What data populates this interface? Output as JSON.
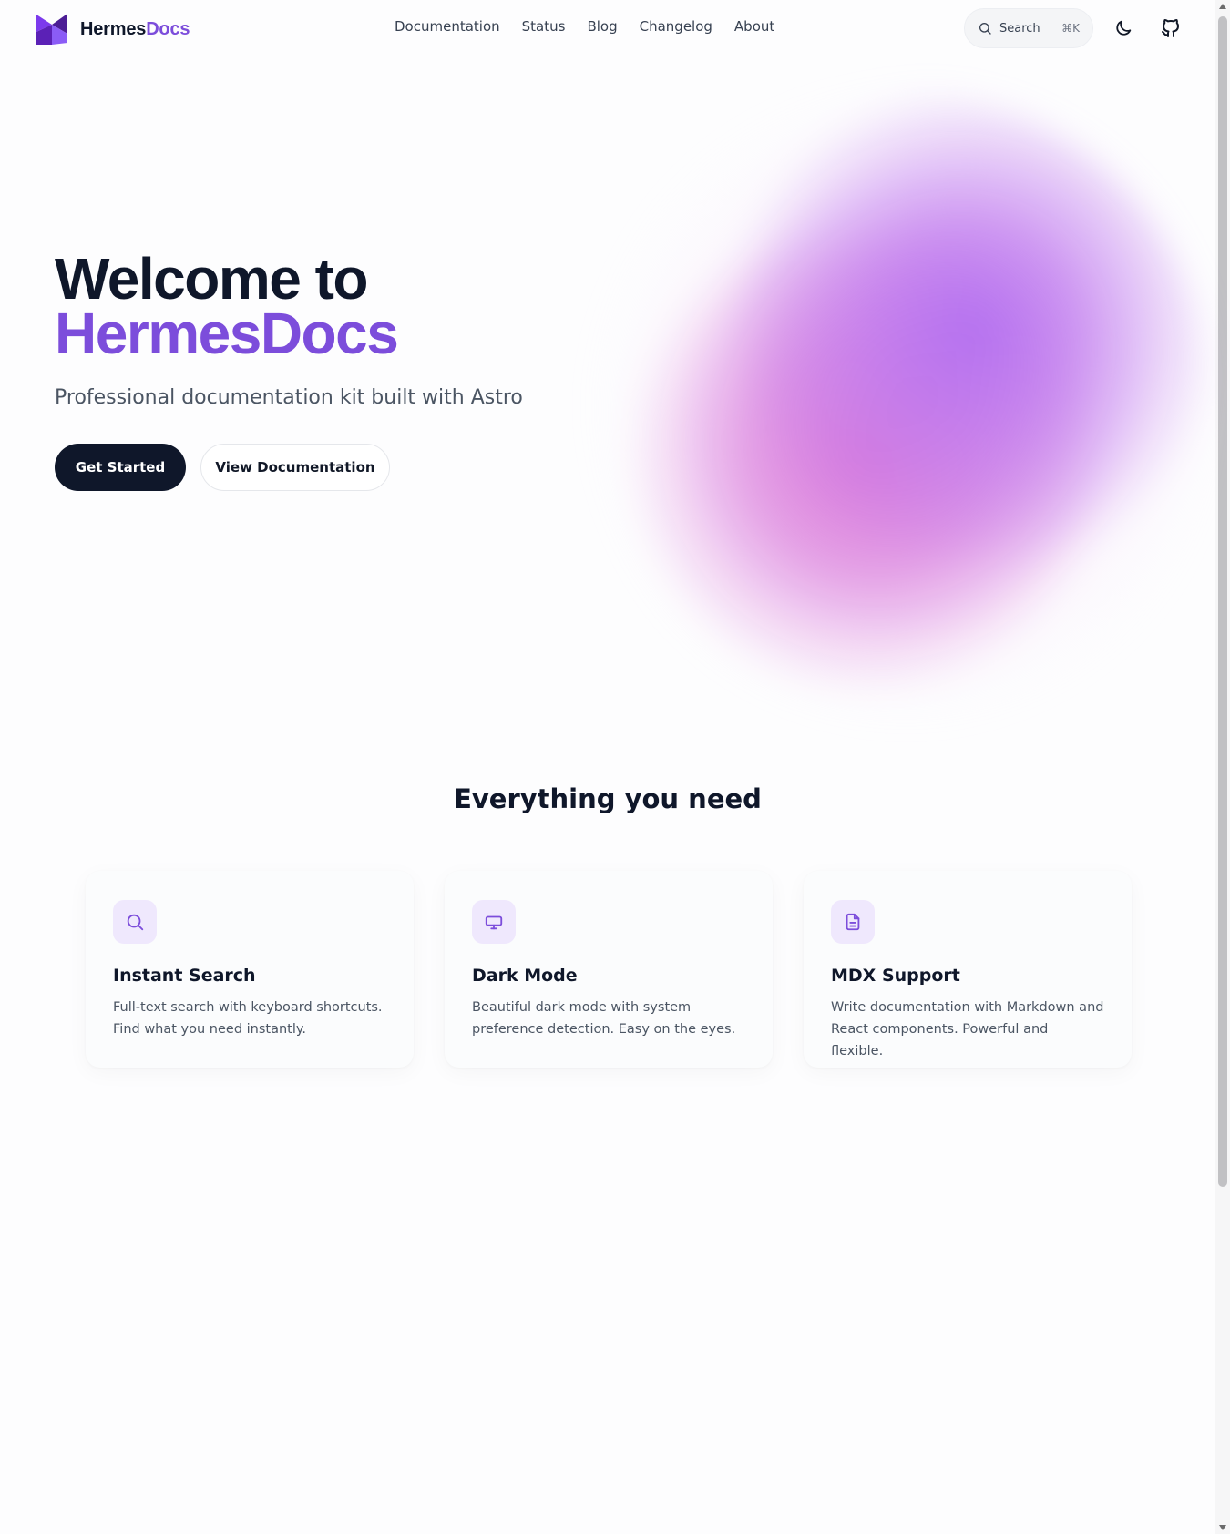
{
  "brand": {
    "name_part1": "Hermes",
    "name_part2": "Docs",
    "logo_icon": "hermes-logo-icon",
    "accent_color": "#7c4ddb",
    "logo_colors": [
      "#7c3aed",
      "#4c1d95",
      "#a78bfa"
    ]
  },
  "nav": {
    "items": [
      {
        "label": "Documentation"
      },
      {
        "label": "Status"
      },
      {
        "label": "Blog"
      },
      {
        "label": "Changelog"
      },
      {
        "label": "About"
      }
    ]
  },
  "header": {
    "search": {
      "label": "Search",
      "shortcut": "⌘K",
      "icon": "search-icon"
    },
    "theme_toggle_icon": "moon-icon",
    "github_icon": "github-icon"
  },
  "hero": {
    "title_line1": "Welcome to",
    "title_line2": "HermesDocs",
    "subtitle": "Professional documentation kit built with Astro",
    "primary_button": "Get Started",
    "secondary_button": "View Documentation",
    "primary_button_color": "#0f172a"
  },
  "features": {
    "heading": "Everything you need",
    "cards": [
      {
        "icon": "search-icon",
        "title": "Instant Search",
        "description": "Full-text search with keyboard shortcuts. Find what you need instantly."
      },
      {
        "icon": "monitor-icon",
        "title": "Dark Mode",
        "description": "Beautiful dark mode with system preference detection. Easy on the eyes."
      },
      {
        "icon": "document-icon",
        "title": "MDX Support",
        "description": "Write documentation with Markdown and React components. Powerful and flexible."
      }
    ]
  }
}
